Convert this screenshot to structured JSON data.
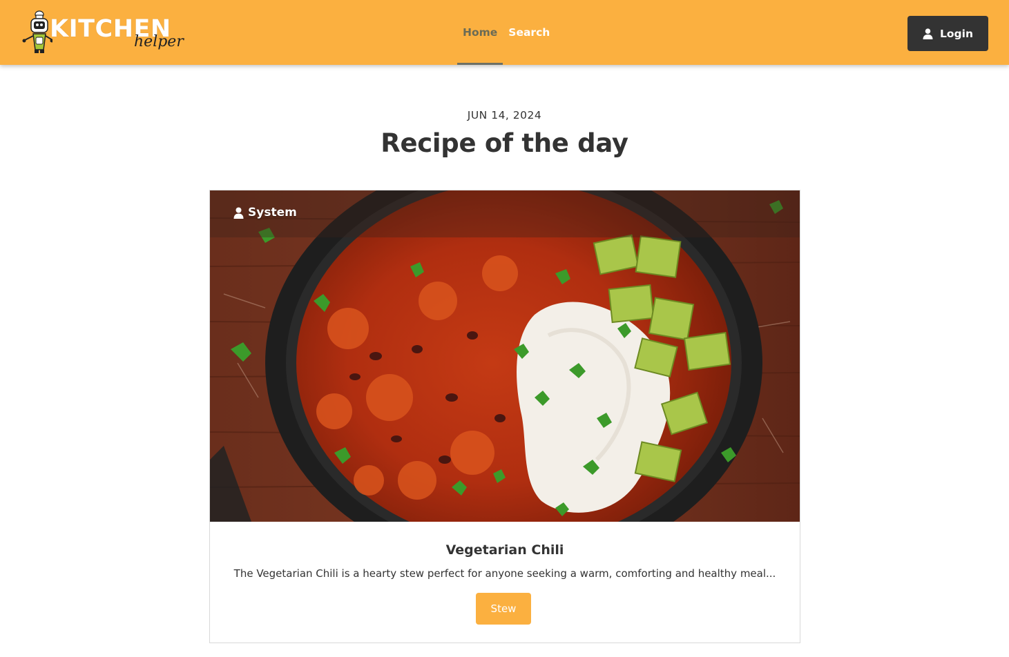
{
  "header": {
    "brand": {
      "word": "KITCHEN",
      "sub": "helper"
    },
    "nav": [
      {
        "label": "Home",
        "active": true
      },
      {
        "label": "Search",
        "active": false
      }
    ],
    "login_label": "Login",
    "login_icon": "user-icon"
  },
  "hero": {
    "date": "JUN 14, 2024",
    "title": "Recipe of the day"
  },
  "recipe": {
    "author": "System",
    "author_icon": "user-icon",
    "image": "chili-bowl-photo",
    "title": "Vegetarian Chili",
    "description": "The Vegetarian Chili is a hearty stew perfect for anyone seeking a warm, comforting and healthy meal...",
    "tag": "Stew"
  },
  "colors": {
    "accent": "#fbb040",
    "dark": "#333333",
    "nav_active": "#6b6b55"
  }
}
